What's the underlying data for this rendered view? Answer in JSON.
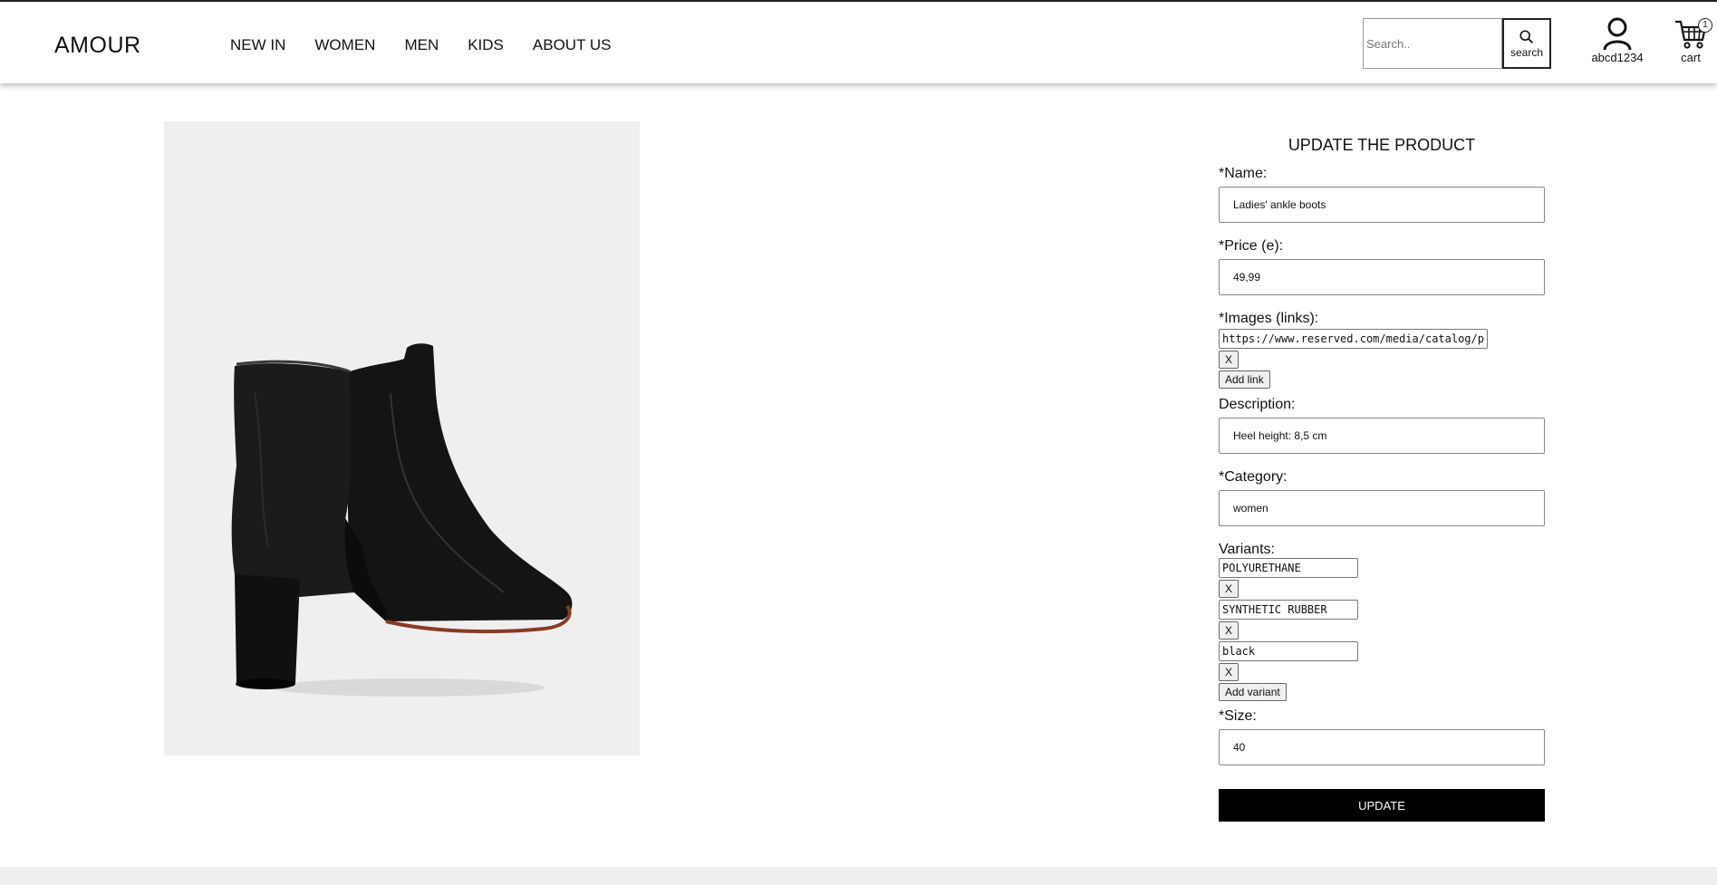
{
  "header": {
    "logo": "AMOUR",
    "nav": [
      "NEW IN",
      "WOMEN",
      "MEN",
      "KIDS",
      "ABOUT US"
    ],
    "search_placeholder": "Search..",
    "search_label": "search",
    "account_label": "abcd1234",
    "cart_label": "cart",
    "cart_count": "1"
  },
  "product_image": {
    "alt": "black leather ankle boot"
  },
  "form": {
    "title": "UPDATE THE PRODUCT",
    "name_label": "*Name:",
    "name_value": "Ladies' ankle boots",
    "price_label": "*Price (e):",
    "price_value": "49,99",
    "images_label": "*Images (links):",
    "image_link": "https://www.reserved.com/media/catalog/product/",
    "remove_label": "X",
    "add_link_label": "Add link",
    "description_label": "Description:",
    "description_value": "Heel height: 8,5 cm",
    "category_label": "*Category:",
    "category_value": "women",
    "variants_label": "Variants:",
    "variants": [
      "POLYURETHANE",
      "SYNTHETIC RUBBER",
      "black"
    ],
    "add_variant_label": "Add variant",
    "size_label": "*Size:",
    "size_value": "40",
    "update_label": "UPDATE"
  }
}
